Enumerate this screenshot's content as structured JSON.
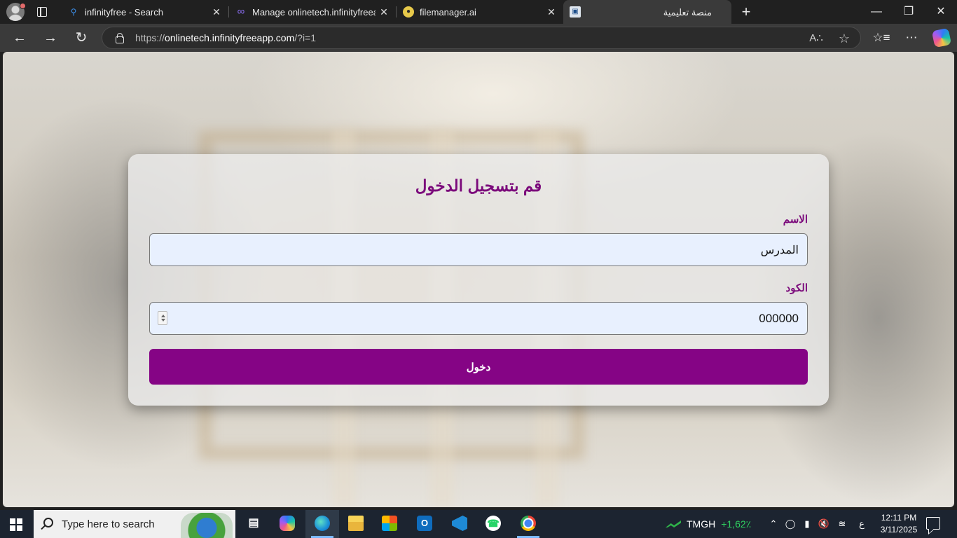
{
  "browser": {
    "tabs": [
      {
        "title": "infinityfree - Search",
        "icon": "search-icon"
      },
      {
        "title": "Manage onlinetech.infinityfreeapp.com",
        "icon": "infinity-icon"
      },
      {
        "title": "filemanager.ai",
        "icon": "filemanager-icon"
      },
      {
        "title": "منصة تعليمية",
        "icon": "site-icon"
      }
    ],
    "url_scheme": "https://",
    "url_host": "onlinetech.infinityfreeapp.com",
    "url_path": "/?i=1",
    "colors": {
      "frame": "#202020",
      "toolbar": "#3a3a3a"
    }
  },
  "login": {
    "title": "قم بتسجيل الدخول",
    "name_label": "الاسم",
    "name_value": "المدرس",
    "code_label": "الكود",
    "code_value": "000000",
    "submit_label": "دخول",
    "colors": {
      "accent": "#850485",
      "heading": "#7b0a7b",
      "input_bg": "#e8f0fe"
    }
  },
  "taskbar": {
    "search_placeholder": "Type here to search",
    "apps": [
      "task-view",
      "copilot",
      "edge",
      "file-explorer",
      "microsoft-store",
      "outlook",
      "vscode",
      "whatsapp",
      "chrome"
    ],
    "stock_symbol": "TMGH",
    "stock_change": "+1,62٪",
    "language": "ع",
    "time": "12:11 PM",
    "date": "3/11/2025"
  }
}
